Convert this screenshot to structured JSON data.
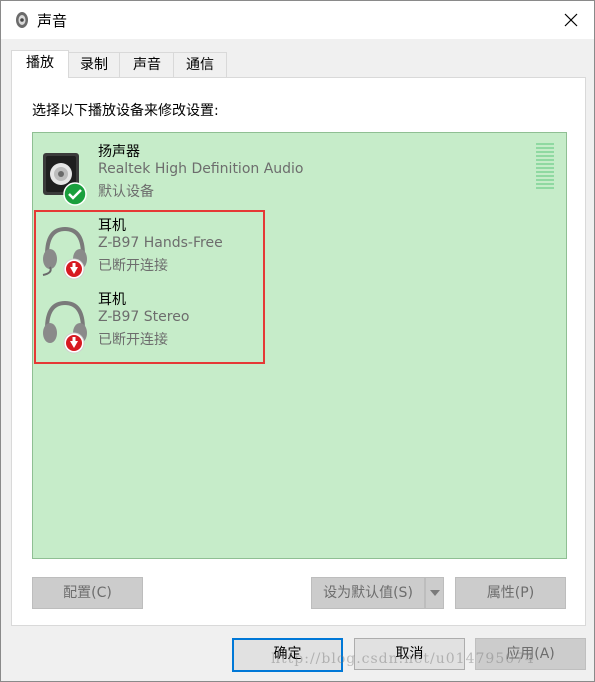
{
  "window": {
    "title": "声音",
    "icon": "speaker-icon",
    "close_icon": "close-icon"
  },
  "tabs": [
    {
      "label": "播放",
      "active": true
    },
    {
      "label": "录制",
      "active": false
    },
    {
      "label": "声音",
      "active": false
    },
    {
      "label": "通信",
      "active": false
    }
  ],
  "instruction": "选择以下播放设备来修改设置:",
  "devices": [
    {
      "name": "扬声器",
      "description": "Realtek High Definition Audio",
      "status": "默认设备",
      "icon": "speaker-device-icon",
      "badge": "default-check-icon"
    },
    {
      "name": "耳机",
      "description": "Z-B97 Hands-Free",
      "status": "已断开连接",
      "icon": "headset-icon",
      "badge": "disconnected-arrow-icon"
    },
    {
      "name": "耳机",
      "description": "Z-B97 Stereo",
      "status": "已断开连接",
      "icon": "headset-icon",
      "badge": "disconnected-arrow-icon"
    }
  ],
  "buttons": {
    "configure": "配置(C)",
    "set_default": "设为默认值(S)",
    "properties": "属性(P)",
    "ok": "确定",
    "cancel": "取消",
    "apply": "应用(A)"
  },
  "watermark": "http://blog.csdn.net/u014795074",
  "colors": {
    "list_background": "#c6ecc9",
    "highlight_border": "#e53935",
    "primary_button_border": "#0078d7",
    "check_badge": "#1a9f3d",
    "disconnect_badge": "#d71921"
  }
}
